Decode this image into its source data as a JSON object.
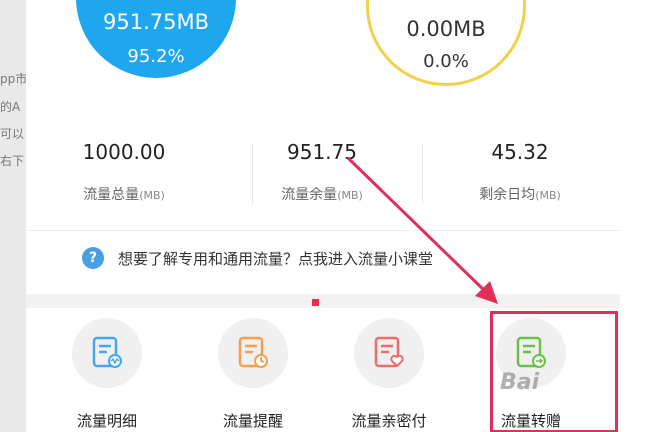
{
  "background_text": [
    "pp市",
    "的A",
    "可以",
    "右下"
  ],
  "circles": {
    "general": {
      "amount": "951.75MB",
      "percent": "95.2%"
    },
    "special": {
      "amount": "0.00MB",
      "percent": "0.0%"
    }
  },
  "stats": [
    {
      "value": "1000.00",
      "label": "流量总量",
      "unit": "(MB)"
    },
    {
      "value": "951.75",
      "label": "流量余量",
      "unit": "(MB)"
    },
    {
      "value": "45.32",
      "label": "剩余日均",
      "unit": "(MB)"
    }
  ],
  "info": {
    "text": "想要了解专用和通用流量？点我进入流量小课堂"
  },
  "functions": [
    {
      "label": "流量明细",
      "icon": "traffic-detail-icon",
      "color": "#47a8e8"
    },
    {
      "label": "流量提醒",
      "icon": "traffic-alert-icon",
      "color": "#f0a050"
    },
    {
      "label": "流量亲密付",
      "icon": "family-pay-icon",
      "color": "#ee6b6b"
    },
    {
      "label": "流量转赠",
      "icon": "traffic-transfer-icon",
      "color": "#6cc04a"
    }
  ],
  "watermark": "Bai",
  "colors": {
    "primary": "#1ea7ef",
    "ring": "#f2d04a",
    "annotation": "#e0305a"
  }
}
